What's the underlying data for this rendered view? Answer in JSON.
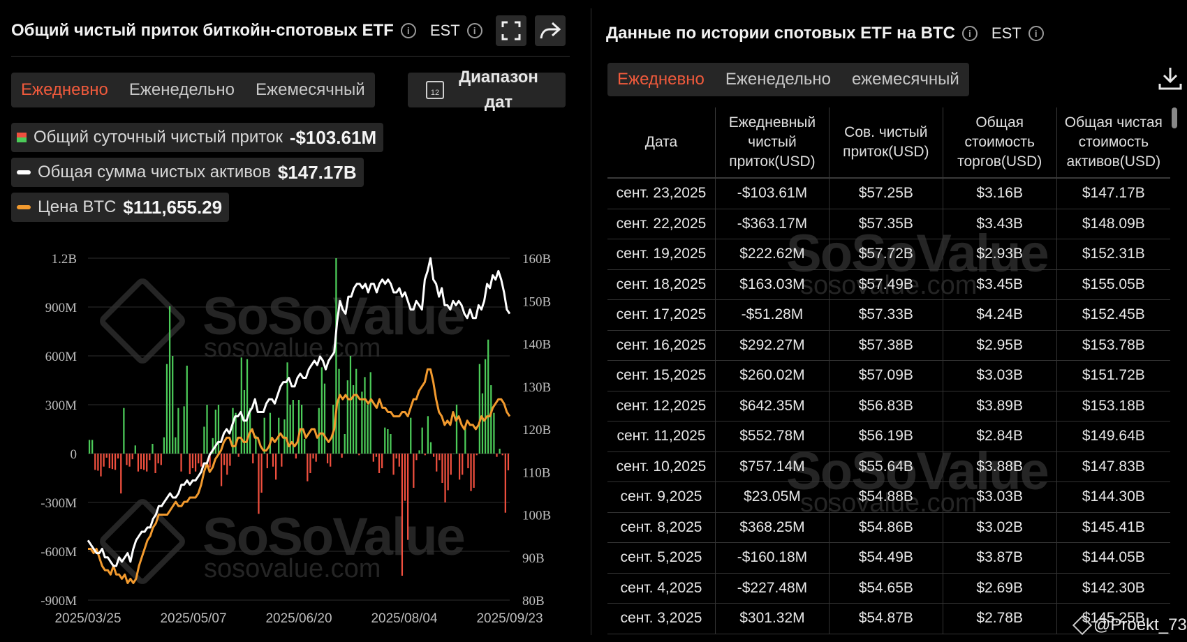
{
  "left_panel": {
    "title": "Общий чистый приток биткойн-спотовых ETF",
    "timezone": "EST",
    "tabs": [
      "Ежедневно",
      "Еженедельно",
      "Ежемесячный"
    ],
    "active_tab": "Ежедневно",
    "date_range_label_line1": "Диапазон",
    "date_range_label_line2": "дат",
    "calendar_day": "12",
    "legend": [
      {
        "label": "Общий суточный чистый приток",
        "value": "-$103.61M",
        "color": "#ef4f3e"
      },
      {
        "label": "Общая сумма чистых активов",
        "value": "$147.17B",
        "color": "#ffffff"
      },
      {
        "label": "Цена BTC",
        "value": "$111,655.29",
        "color": "#f29a2e"
      }
    ]
  },
  "watermark": {
    "brand": "SoSoValue",
    "domain": "sosovalue.com"
  },
  "chart_data": {
    "type": "bar",
    "x_tick_labels": [
      "2025/03/25",
      "2025/05/07",
      "2025/06/20",
      "2025/08/04",
      "2025/09/23"
    ],
    "y_left_ticks": [
      "1.2B",
      "900M",
      "600M",
      "300M",
      "0",
      "-300M",
      "-600M",
      "-900M"
    ],
    "y_left_range": [
      -900,
      1200
    ],
    "y_left_unit": "M USD",
    "y_right_ticks": [
      "160B",
      "150B",
      "140B",
      "130B",
      "120B",
      "110B",
      "100B",
      "90B",
      "80B"
    ],
    "y_right_range": [
      80,
      160
    ],
    "y_right_unit": "B USD",
    "grid": true,
    "series": [
      {
        "name": "Общий суточный чистый приток",
        "kind": "bar",
        "positive_color": "#4ccb59",
        "negative_color": "#ef4f3e",
        "values": [
          84,
          84,
          -100,
          -105,
          -140,
          -80,
          -25,
          -90,
          -95,
          -100,
          -30,
          -245,
          280,
          -70,
          -80,
          -35,
          50,
          -110,
          -95,
          -100,
          -110,
          -40,
          60,
          -120,
          -60,
          -70,
          100,
          550,
          905,
          600,
          100,
          280,
          -110,
          290,
          540,
          -125,
          -90,
          -110,
          -60,
          -80,
          165,
          300,
          -85,
          95,
          270,
          300,
          -200,
          -70,
          -130,
          -75,
          280,
          250,
          -20,
          590,
          390,
          580,
          280,
          -60,
          110,
          -370,
          -240,
          220,
          -90,
          250,
          -80,
          -160,
          220,
          -80,
          210,
          560,
          300,
          330,
          -30,
          330,
          300,
          90,
          -170,
          -120,
          -30,
          -50,
          280,
          530,
          430,
          -60,
          -80,
          300,
          1200,
          520,
          -25,
          120,
          450,
          600,
          420,
          520,
          -10,
          380,
          470,
          300,
          500,
          -50,
          -20,
          -120,
          -90,
          160,
          150,
          120,
          -130,
          -30,
          -80,
          -750,
          -290,
          -530,
          220,
          -210,
          -40,
          20,
          160,
          -10,
          230,
          70,
          -20,
          -110,
          -40,
          -180,
          -300,
          -225,
          -130,
          0,
          301,
          -160,
          -130,
          160,
          -90,
          -230,
          -210,
          -10,
          550,
          370,
          580,
          700,
          420,
          250,
          -20,
          30,
          -10,
          -363,
          -103
        ]
      },
      {
        "name": "Общая сумма чистых активов",
        "kind": "line",
        "color": "#ffffff",
        "axis": "right",
        "values": [
          94,
          93,
          92,
          91,
          91,
          92,
          90,
          90,
          89,
          88,
          88,
          90,
          89,
          90,
          91,
          89,
          92,
          94,
          95,
          96,
          96,
          97,
          97,
          99,
          100,
          102,
          102,
          103,
          104,
          105,
          104,
          104,
          105,
          107,
          107,
          108,
          107,
          108,
          108,
          109,
          110,
          112,
          112,
          114,
          115,
          116,
          117,
          117,
          119,
          120,
          119,
          121,
          123,
          123,
          124,
          122,
          122,
          124,
          125,
          127,
          124,
          124,
          124,
          126,
          127,
          127,
          126,
          128,
          130,
          131,
          131,
          132,
          130,
          130,
          132,
          133,
          132,
          132,
          134,
          135,
          136,
          135,
          137,
          136,
          134,
          136,
          137,
          138,
          145,
          150,
          148,
          147,
          151,
          151,
          153,
          154,
          154,
          153,
          154,
          152,
          154,
          154,
          152,
          154,
          155,
          154,
          155,
          154,
          152,
          152,
          153,
          151,
          152,
          150,
          148,
          148,
          150,
          149,
          148,
          155,
          157,
          160,
          155,
          154,
          151,
          153,
          149,
          149,
          148,
          150,
          149,
          150,
          149,
          147,
          146,
          148,
          146,
          146,
          149,
          148,
          150,
          154,
          153,
          156,
          155,
          157,
          155,
          152,
          148,
          147
        ]
      },
      {
        "name": "Цена BTC",
        "kind": "line",
        "color": "#f29a2e",
        "axis": "right",
        "values": [
          92,
          92,
          91,
          92,
          90,
          88,
          87,
          87,
          86,
          88,
          86,
          86,
          85,
          86,
          84,
          85,
          84,
          85,
          88,
          90,
          92,
          94,
          95,
          97,
          98,
          100,
          100,
          100,
          100,
          101,
          102,
          103,
          102,
          102,
          103,
          103,
          104,
          104,
          104,
          105,
          107,
          110,
          112,
          110,
          111,
          113,
          114,
          115,
          117,
          118,
          118,
          116,
          116,
          118,
          118,
          117,
          117,
          119,
          120,
          118,
          118,
          116,
          115,
          115,
          116,
          118,
          117,
          118,
          119,
          118,
          118,
          116,
          117,
          116,
          117,
          120,
          120,
          118,
          119,
          120,
          120,
          118,
          119,
          119,
          118,
          117,
          118,
          120,
          126,
          128,
          127,
          128,
          127,
          127,
          128,
          128,
          127,
          127,
          127,
          126,
          127,
          126,
          125,
          127,
          125,
          125,
          124,
          124,
          123,
          123,
          123,
          124,
          124,
          123,
          125,
          127,
          127,
          129,
          130,
          131,
          134,
          134,
          131,
          127,
          124,
          123,
          121,
          122,
          121,
          124,
          122,
          123,
          121,
          120,
          122,
          121,
          121,
          120,
          121,
          123,
          122,
          123,
          123,
          125,
          126,
          127,
          127,
          126,
          124,
          123
        ]
      }
    ]
  },
  "right_panel": {
    "title": "Данные по истории спотовых ETF на BTC",
    "timezone": "EST",
    "tabs": [
      "Ежедневно",
      "Еженедельно",
      "ежемесячный"
    ],
    "active_tab": "Ежедневно",
    "table": {
      "headers": [
        "Дата",
        "Ежедневный чистый приток(USD)",
        "Сов. чистый приток(USD)",
        "Общая стоимость торгов(USD)",
        "Общая чистая стоимость активов(USD)"
      ],
      "rows": [
        [
          "сент. 23,2025",
          "-$103.61M",
          "$57.25B",
          "$3.16B",
          "$147.17B"
        ],
        [
          "сент. 22,2025",
          "-$363.17M",
          "$57.35B",
          "$3.43B",
          "$148.09B"
        ],
        [
          "сент. 19,2025",
          "$222.62M",
          "$57.72B",
          "$2.93B",
          "$152.31B"
        ],
        [
          "сент. 18,2025",
          "$163.03M",
          "$57.49B",
          "$3.45B",
          "$155.05B"
        ],
        [
          "сент. 17,2025",
          "-$51.28M",
          "$57.33B",
          "$4.24B",
          "$152.45B"
        ],
        [
          "сент. 16,2025",
          "$292.27M",
          "$57.38B",
          "$2.95B",
          "$153.78B"
        ],
        [
          "сент. 15,2025",
          "$260.02M",
          "$57.09B",
          "$3.03B",
          "$151.72B"
        ],
        [
          "сент. 12,2025",
          "$642.35M",
          "$56.83B",
          "$3.89B",
          "$153.18B"
        ],
        [
          "сент. 11,2025",
          "$552.78M",
          "$56.19B",
          "$2.84B",
          "$149.64B"
        ],
        [
          "сент. 10,2025",
          "$757.14M",
          "$55.64B",
          "$3.88B",
          "$147.83B"
        ],
        [
          "сент. 9,2025",
          "$23.05M",
          "$54.88B",
          "$3.03B",
          "$144.30B"
        ],
        [
          "сент. 8,2025",
          "$368.25M",
          "$54.86B",
          "$3.02B",
          "$145.41B"
        ],
        [
          "сент. 5,2025",
          "-$160.18M",
          "$54.49B",
          "$3.87B",
          "$144.05B"
        ],
        [
          "сент. 4,2025",
          "-$227.48M",
          "$54.65B",
          "$2.69B",
          "$142.30B"
        ],
        [
          "сент. 3,2025",
          "$301.32M",
          "$54.87B",
          "$2.78B",
          "$145.25B"
        ]
      ]
    }
  },
  "handle": "@Proekt_73"
}
